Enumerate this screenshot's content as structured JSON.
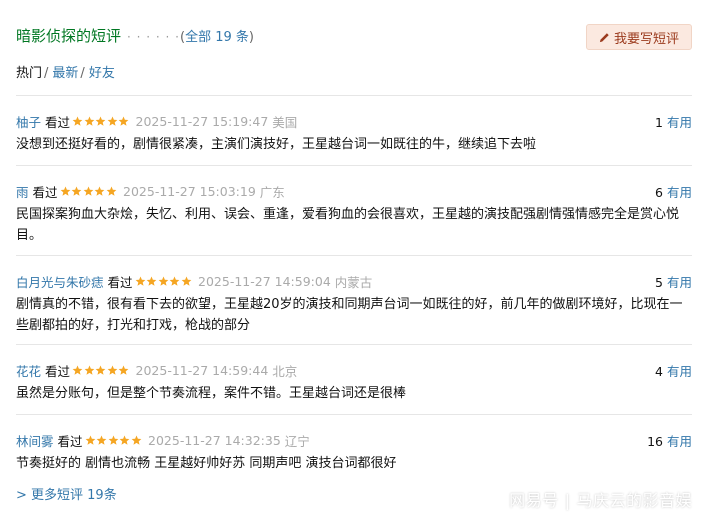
{
  "header": {
    "title": "暗影侦探的短评",
    "dots": "· · · · · ·",
    "total_open": "(",
    "total_link": "全部 19 条",
    "total_close": ")",
    "write_button": "我要写短评",
    "pencil_icon": "pencil-icon"
  },
  "tabs": [
    {
      "label": "热门",
      "sep": "/"
    },
    {
      "label": "最新",
      "sep": "/"
    },
    {
      "label": "好友",
      "sep": ""
    }
  ],
  "watched_label": "看过",
  "useful_label": "有用",
  "star_color": "#f5a623",
  "comments": [
    {
      "user": "柚子",
      "rating": 5,
      "time": "2025-11-27 15:19:47",
      "location": "美国",
      "useful": "1",
      "content": "没想到还挺好看的，剧情很紧凑，主演们演技好，王星越台词一如既往的牛，继续追下去啦"
    },
    {
      "user": "雨",
      "rating": 5,
      "time": "2025-11-27 15:03:19",
      "location": "广东",
      "useful": "6",
      "content": "民国探案狗血大杂烩，失忆、利用、误会、重逢，爱看狗血的会很喜欢，王星越的演技配强剧情强情感完全是赏心悦目。"
    },
    {
      "user": "白月光与朱砂痣",
      "rating": 5,
      "time": "2025-11-27 14:59:04",
      "location": "内蒙古",
      "useful": "5",
      "content": "剧情真的不错，很有看下去的欲望，王星越20岁的演技和同期声台词一如既往的好，前几年的做剧环境好，比现在一些剧都拍的好，打光和打戏，枪战的部分"
    },
    {
      "user": "花花",
      "rating": 5,
      "time": "2025-11-27 14:59:44",
      "location": "北京",
      "useful": "4",
      "content": "虽然是分账句，但是整个节奏流程，案件不错。王星越台词还是很棒"
    },
    {
      "user": "林间雾",
      "rating": 5,
      "time": "2025-11-27 14:32:35",
      "location": "辽宁",
      "useful": "16",
      "content": "节奏挺好的 剧情也流畅 王星越好帅好苏 同期声吧 演技台词都很好"
    }
  ],
  "more_link": "> 更多短评 19条",
  "watermark": {
    "brand": "网易号",
    "author": "马庆云的影音娱"
  }
}
